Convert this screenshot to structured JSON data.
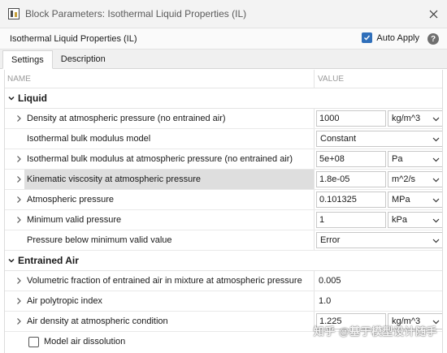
{
  "window": {
    "title": "Block Parameters: Isothermal Liquid Properties (IL)",
    "close_icon": "close-icon",
    "app_icon": "block-parameters-icon"
  },
  "header": {
    "block_name": "Isothermal Liquid Properties (IL)",
    "auto_apply_label": "Auto Apply",
    "auto_apply_checked": true,
    "help_label": "?"
  },
  "tabs": [
    {
      "label": "Settings",
      "active": true
    },
    {
      "label": "Description",
      "active": false
    }
  ],
  "columns": {
    "name": "NAME",
    "value": "VALUE"
  },
  "sections": {
    "liquid": {
      "label": "Liquid",
      "rows": [
        {
          "name": "Density at atmospheric pressure (no entrained air)",
          "value": "1000",
          "unit": "kg/m^3"
        },
        {
          "name": "Isothermal bulk modulus model",
          "value": "Constant"
        },
        {
          "name": "Isothermal bulk modulus at atmospheric pressure (no entrained air)",
          "value": "5e+08",
          "unit": "Pa"
        },
        {
          "name": "Kinematic viscosity at atmospheric pressure",
          "value": "1.8e-05",
          "unit": "m^2/s"
        },
        {
          "name": "Atmospheric pressure",
          "value": "0.101325",
          "unit": "MPa"
        },
        {
          "name": "Minimum valid pressure",
          "value": "1",
          "unit": "kPa"
        },
        {
          "name": "Pressure below minimum valid value",
          "value": "Error"
        }
      ]
    },
    "entrained_air": {
      "label": "Entrained Air",
      "rows": [
        {
          "name": "Volumetric fraction of entrained air in mixture at atmospheric pressure",
          "value": "0.005"
        },
        {
          "name": "Air polytropic index",
          "value": "1.0"
        },
        {
          "name": "Air density at atmospheric condition",
          "value": "1.225",
          "unit": "kg/m^3"
        }
      ],
      "checkbox": {
        "label": "Model air dissolution",
        "checked": false
      }
    }
  },
  "watermark": "知乎 @基于模型设计随手",
  "colors": {
    "accent": "#2f6fba",
    "row_highlight": "#dedede",
    "titlebar": "#f3f3f3"
  }
}
